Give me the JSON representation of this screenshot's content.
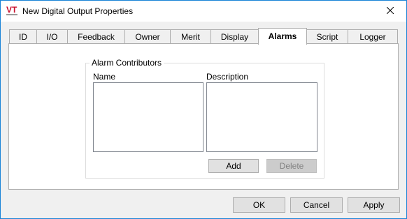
{
  "window": {
    "title": "New Digital Output Properties",
    "app_icon": "vt-scada-logo-icon",
    "close_icon": "close-icon",
    "accent_color": "#1883d7"
  },
  "tabs": [
    {
      "label": "ID",
      "active": false
    },
    {
      "label": "I/O",
      "active": false
    },
    {
      "label": "Feedback",
      "active": false
    },
    {
      "label": "Owner",
      "active": false
    },
    {
      "label": "Merit",
      "active": false
    },
    {
      "label": "Display",
      "active": false
    },
    {
      "label": "Alarms",
      "active": true
    },
    {
      "label": "Script",
      "active": false
    },
    {
      "label": "Logger",
      "active": false
    }
  ],
  "alarm_contributors": {
    "group_title": "Alarm Contributors",
    "name_header": "Name",
    "description_header": "Description",
    "name_items": [],
    "description_items": [],
    "add_label": "Add",
    "delete_label": "Delete",
    "delete_enabled": false
  },
  "footer": {
    "ok_label": "OK",
    "cancel_label": "Cancel",
    "apply_label": "Apply"
  }
}
